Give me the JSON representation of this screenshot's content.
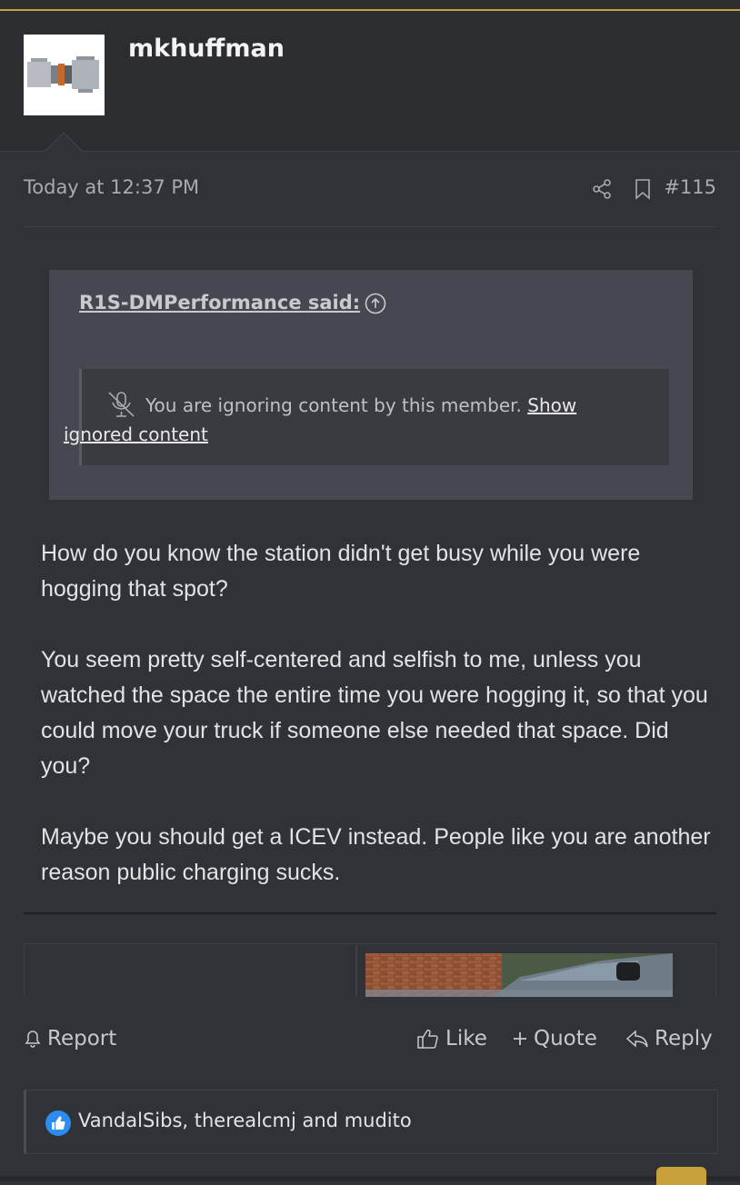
{
  "post": {
    "username": "mkhuffman",
    "timestamp": "Today at 12:37 PM",
    "post_number": "#115"
  },
  "quote": {
    "author": "R1S-DMPerformance said:",
    "ignored_text": "You are ignoring content by this member.",
    "show_link_1": "Show",
    "show_link_2": "ignored content"
  },
  "body": {
    "paragraphs": [
      "How do you know the station didn't get busy while you were hogging that spot?",
      "You seem pretty self-centered and selfish to me, unless you watched the space the entire time you were hogging it, so that you could move your truck if someone else needed that space. Did you?",
      "Maybe you should get a ICEV instead. People like you are another reason public charging sucks."
    ]
  },
  "actions": {
    "report": "Report",
    "like": "Like",
    "quote": "Quote",
    "reply": "Reply"
  },
  "reactions": {
    "text": "VandalSibs, therealcmj and mudito"
  },
  "colors": {
    "accent": "#c9a13a",
    "like_blue": "#2d8cf0",
    "background": "#2f3237"
  }
}
